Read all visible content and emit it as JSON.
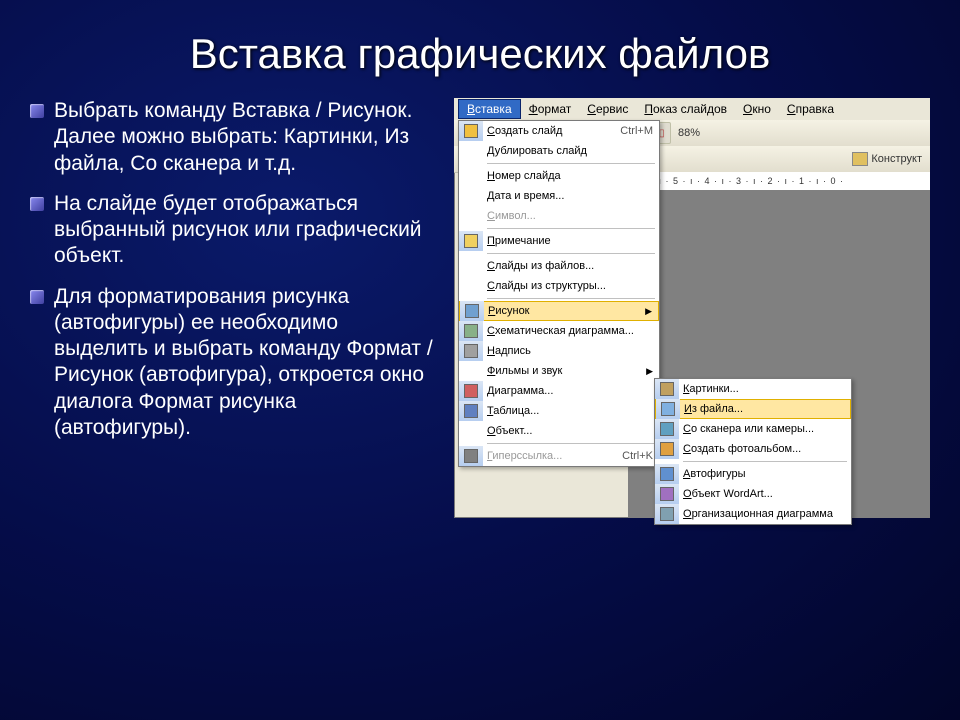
{
  "title": "Вставка графических файлов",
  "bullets": [
    "Выбрать команду Вставка / Рисунок. Далее можно выбрать: Картинки, Из файла, Со сканера и т.д.",
    "На слайде будет отображаться выбранный рисунок или графический объект.",
    " Для форматирования рисунка (автофигуры) ее необходимо выделить и выбрать команду Формат / Рисунок (автофигура), откроется окно диалога Формат рисунка (автофигуры)."
  ],
  "menubar": {
    "items": [
      "Вставка",
      "Формат",
      "Сервис",
      "Показ слайдов",
      "Окно",
      "Справка"
    ],
    "active_index": 0
  },
  "zoom": "88%",
  "konstruktor": "Конструкт",
  "ruler_text": "· 6 · ı · 5 · ı · 4 · ı · 3 · ı · 2 · ı · 1 · ı · 0 ·",
  "dropdown_main": [
    {
      "ico": "slide",
      "label": "Создать слайд",
      "shortcut": "Ctrl+M",
      "arrow": false,
      "sep": false,
      "disabled": false,
      "bar": true
    },
    {
      "ico": "",
      "label": "Дублировать слайд",
      "shortcut": "",
      "arrow": false,
      "sep": false,
      "disabled": false,
      "bar": false
    },
    {
      "sep": true
    },
    {
      "ico": "",
      "label": "Номер слайда",
      "shortcut": "",
      "arrow": false,
      "sep": false,
      "disabled": false,
      "bar": false
    },
    {
      "ico": "",
      "label": "Дата и время...",
      "shortcut": "",
      "arrow": false,
      "sep": false,
      "disabled": false,
      "bar": false
    },
    {
      "ico": "",
      "label": "Символ...",
      "shortcut": "",
      "arrow": false,
      "sep": false,
      "disabled": true,
      "bar": false
    },
    {
      "sep": true
    },
    {
      "ico": "note",
      "label": "Примечание",
      "shortcut": "",
      "arrow": false,
      "sep": false,
      "disabled": false,
      "bar": true
    },
    {
      "sep": true
    },
    {
      "ico": "",
      "label": "Слайды из файлов...",
      "shortcut": "",
      "arrow": false,
      "sep": false,
      "disabled": false,
      "bar": false
    },
    {
      "ico": "",
      "label": "Слайды из структуры...",
      "shortcut": "",
      "arrow": false,
      "sep": false,
      "disabled": false,
      "bar": false
    },
    {
      "sep": true
    },
    {
      "ico": "pic",
      "label": "Рисунок",
      "shortcut": "",
      "arrow": true,
      "sep": false,
      "disabled": false,
      "bar": true,
      "hover": true
    },
    {
      "ico": "diag",
      "label": "Схематическая диаграмма...",
      "shortcut": "",
      "arrow": false,
      "sep": false,
      "disabled": false,
      "bar": true
    },
    {
      "ico": "text",
      "label": "Надпись",
      "shortcut": "",
      "arrow": false,
      "sep": false,
      "disabled": false,
      "bar": true
    },
    {
      "ico": "",
      "label": "Фильмы и звук",
      "shortcut": "",
      "arrow": true,
      "sep": false,
      "disabled": false,
      "bar": false
    },
    {
      "ico": "chart",
      "label": "Диаграмма...",
      "shortcut": "",
      "arrow": false,
      "sep": false,
      "disabled": false,
      "bar": true
    },
    {
      "ico": "table",
      "label": "Таблица...",
      "shortcut": "",
      "arrow": false,
      "sep": false,
      "disabled": false,
      "bar": true
    },
    {
      "ico": "",
      "label": "Объект...",
      "shortcut": "",
      "arrow": false,
      "sep": false,
      "disabled": false,
      "bar": false
    },
    {
      "sep": true
    },
    {
      "ico": "link",
      "label": "Гиперссылка...",
      "shortcut": "Ctrl+K",
      "arrow": false,
      "sep": false,
      "disabled": true,
      "bar": true
    }
  ],
  "dropdown_sub": [
    {
      "ico": "clip",
      "label": "Картинки...",
      "bar": true
    },
    {
      "ico": "file",
      "label": "Из файла...",
      "bar": true,
      "hover": true
    },
    {
      "ico": "scan",
      "label": "Со сканера или камеры...",
      "bar": true
    },
    {
      "ico": "album",
      "label": "Создать фотоальбом...",
      "bar": true
    },
    {
      "sep": true
    },
    {
      "ico": "shapes",
      "label": "Автофигуры",
      "bar": true
    },
    {
      "ico": "wordart",
      "label": "Объект WordArt...",
      "bar": true
    },
    {
      "ico": "org",
      "label": "Организационная диаграмма",
      "bar": true
    }
  ],
  "icons": {
    "slide": "#f0c040",
    "note": "#f0d060",
    "pic": "#70a0d0",
    "diag": "#88b088",
    "text": "#a0a0a0",
    "chart": "#d06060",
    "table": "#6080c0",
    "link": "#808080",
    "clip": "#c0a060",
    "file": "#80b0e0",
    "scan": "#60a0c0",
    "album": "#e0a040",
    "shapes": "#6090d0",
    "wordart": "#a070c0",
    "org": "#80a0b0"
  }
}
